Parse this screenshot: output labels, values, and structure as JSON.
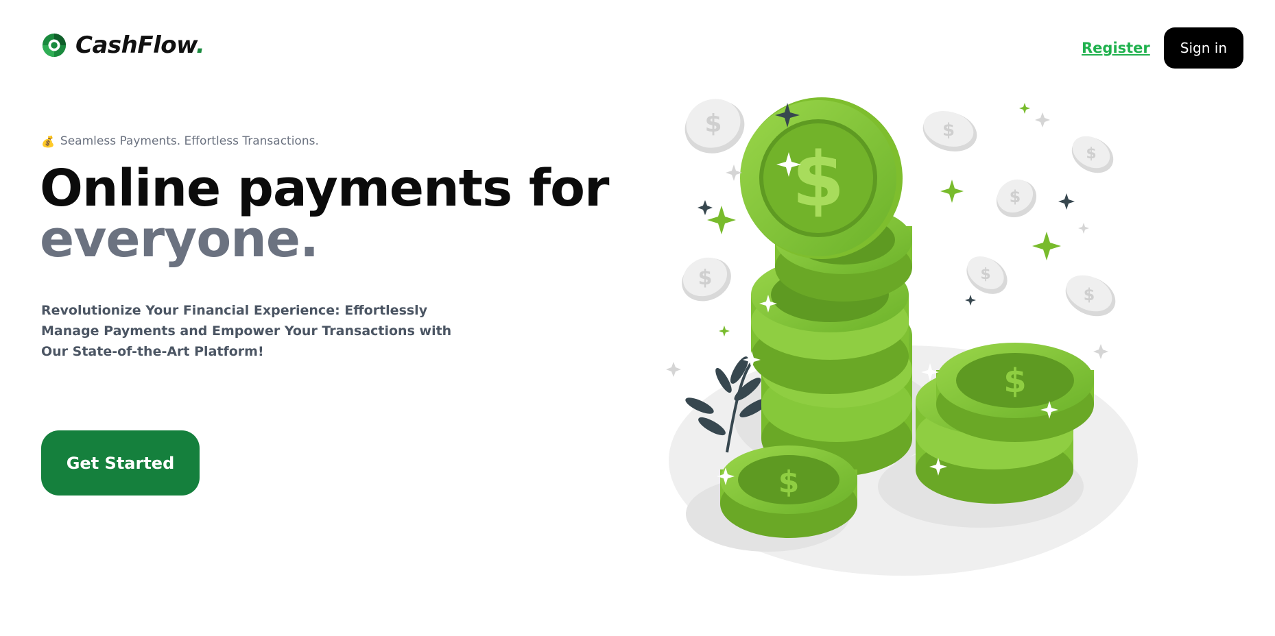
{
  "brand": {
    "name": "CashFlow",
    "dot": ".",
    "accent_color": "#1a8a3e"
  },
  "nav": {
    "register_label": "Register",
    "signin_label": "Sign in"
  },
  "hero": {
    "tagline_icon": "money-bag-icon",
    "tagline": "Seamless Payments. Effortless Transactions.",
    "title_line1": "Online payments for",
    "title_line2": "everyone.",
    "description": "Revolutionize Your Financial Experience: Effortlessly Manage Payments and Empower Your Transactions with Our State-of-the-Art Platform!",
    "cta_label": "Get Started"
  },
  "illustration": {
    "subject": "stacks of green dollar coins",
    "coin_symbol": "$",
    "coin_green": "#7cc02e",
    "coin_dark_green": "#4f8a1a",
    "silver": "#e5e5e5"
  }
}
